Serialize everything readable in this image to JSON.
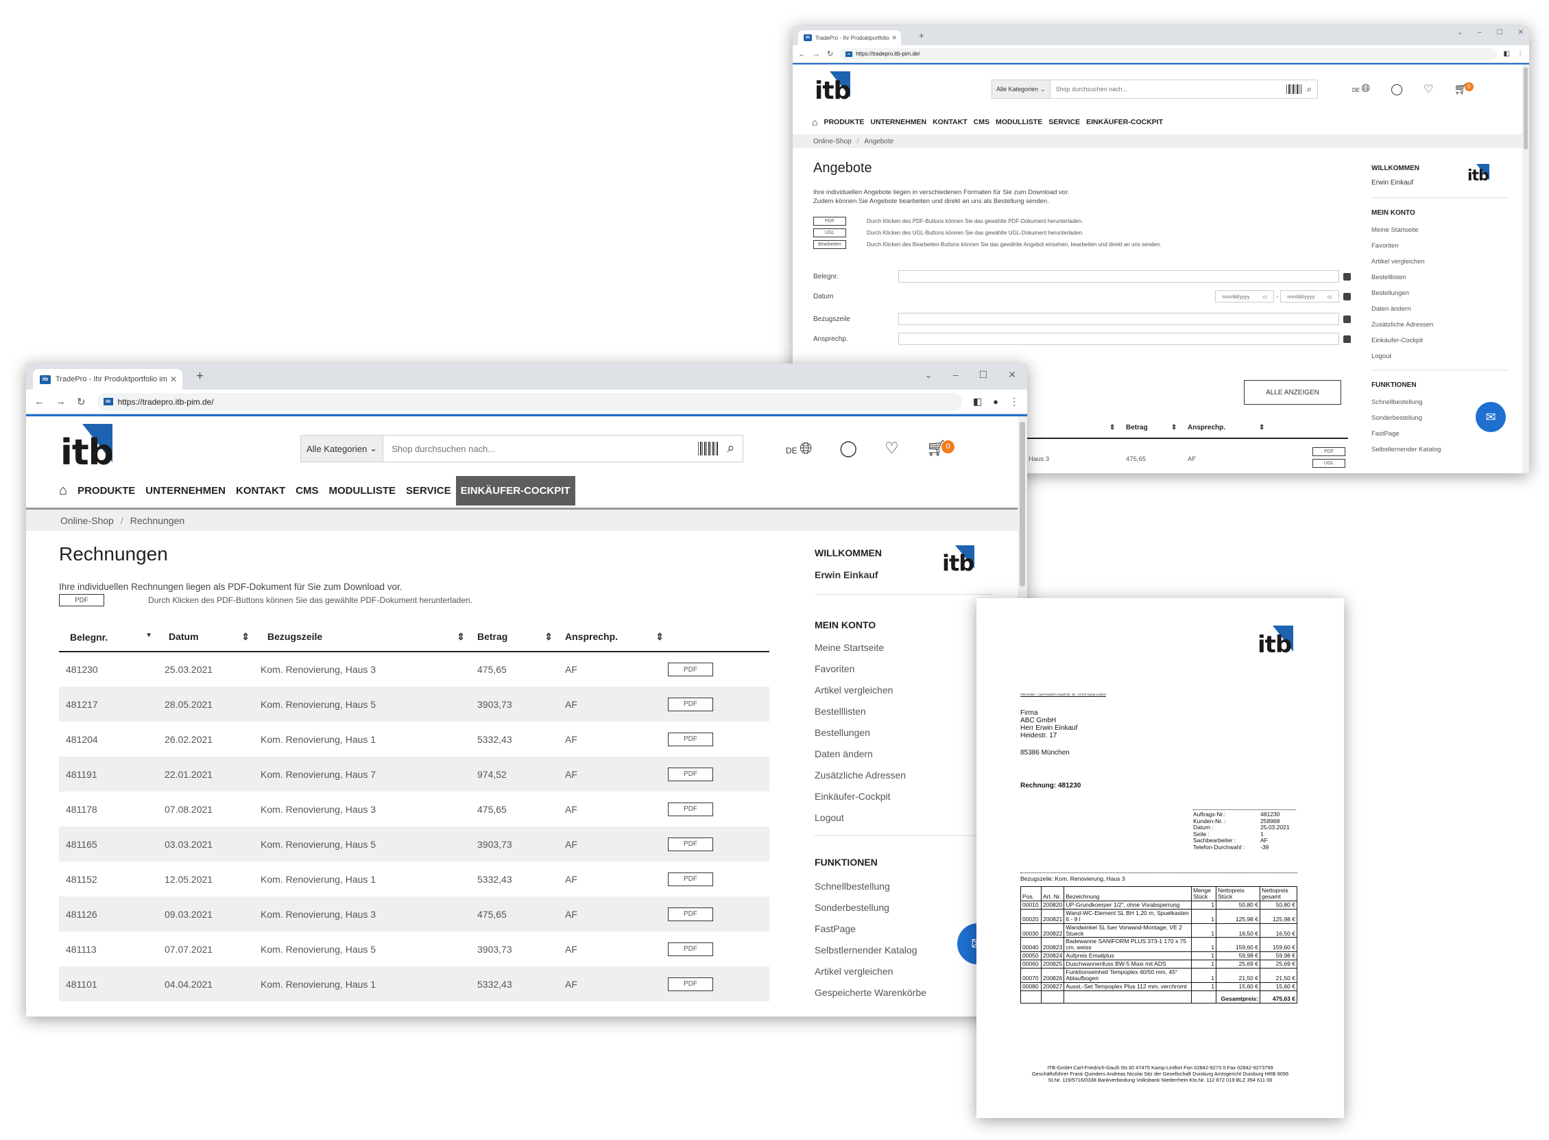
{
  "browser": {
    "tab_title": "TradePro - Ihr Produktportfolio im Überblick",
    "url": "https://tradepro.itb-pim.de/",
    "favicon": "itb"
  },
  "brand": {
    "logo": "itb",
    "color": "#1e63b0",
    "accent": "#f07d1a"
  },
  "header": {
    "category": "Alle Kategorien",
    "search_placeholder": "Shop durchsuchen nach...",
    "lang": "DE",
    "cart_count": "0"
  },
  "nav": [
    "PRODUKTE",
    "UNTERNEHMEN",
    "KONTAKT",
    "CMS",
    "MODULLISTE",
    "SERVICE",
    "EINKÄUFER-COCKPIT"
  ],
  "front": {
    "breadcrumb": [
      "Online-Shop",
      "Rechnungen"
    ],
    "title": "Rechnungen",
    "intro": "Ihre individuellen Rechnungen liegen als PDF-Dokument für Sie zum Download vor.",
    "pdf_legend": "Durch Klicken des PDF-Buttons können Sie das gewählte PDF-Dokument herunterladen.",
    "columns": [
      "Belegnr.",
      "Datum",
      "Bezugszeile",
      "Betrag",
      "Ansprechp."
    ],
    "rows": [
      {
        "beleg": "481230",
        "datum": "25.03.2021",
        "bezug": "Kom. Renovierung, Haus 3",
        "betrag": "475,65",
        "ansp": "AF"
      },
      {
        "beleg": "481217",
        "datum": "28.05.2021",
        "bezug": "Kom. Renovierung, Haus 5",
        "betrag": "3903,73",
        "ansp": "AF"
      },
      {
        "beleg": "481204",
        "datum": "26.02.2021",
        "bezug": "Kom. Renovierung, Haus 1",
        "betrag": "5332,43",
        "ansp": "AF"
      },
      {
        "beleg": "481191",
        "datum": "22.01.2021",
        "bezug": "Kom. Renovierung, Haus 7",
        "betrag": "974,52",
        "ansp": "AF"
      },
      {
        "beleg": "481178",
        "datum": "07.08.2021",
        "bezug": "Kom. Renovierung, Haus 3",
        "betrag": "475,65",
        "ansp": "AF"
      },
      {
        "beleg": "481165",
        "datum": "03.03.2021",
        "bezug": "Kom. Renovierung, Haus 5",
        "betrag": "3903,73",
        "ansp": "AF"
      },
      {
        "beleg": "481152",
        "datum": "12.05.2021",
        "bezug": "Kom. Renovierung, Haus 1",
        "betrag": "5332,43",
        "ansp": "AF"
      },
      {
        "beleg": "481126",
        "datum": "09.03.2021",
        "bezug": "Kom. Renovierung, Haus 3",
        "betrag": "475,65",
        "ansp": "AF"
      },
      {
        "beleg": "481113",
        "datum": "07.07.2021",
        "bezug": "Kom. Renovierung, Haus 5",
        "betrag": "3903,73",
        "ansp": "AF"
      },
      {
        "beleg": "481101",
        "datum": "04.04.2021",
        "bezug": "Kom. Renovierung, Haus 1",
        "betrag": "5332,43",
        "ansp": "AF"
      }
    ],
    "pdf_label": "PDF"
  },
  "sidebar": {
    "welcome": "WILLKOMMEN",
    "user": "Erwin Einkauf",
    "account_title": "MEIN KONTO",
    "account": [
      "Meine Startseite",
      "Favoriten",
      "Artikel vergleichen",
      "Bestelllisten",
      "Bestellungen",
      "Daten ändern",
      "Zusätzliche Adressen",
      "Einkäufer-Cockpit",
      "Logout"
    ],
    "functions_title": "FUNKTIONEN",
    "functions": [
      "Schnellbestellung",
      "Sonderbestellung",
      "FastPage",
      "Selbstlernender Katalog",
      "Artikel vergleichen",
      "Gespeicherte Warenkörbe"
    ]
  },
  "back": {
    "breadcrumb": [
      "Online-Shop",
      "Angebote"
    ],
    "title": "Angebote",
    "intro1": "Ihre individuellen Angebote liegen in verschiedenen Formaten für Sie zum Download vor.",
    "intro2": "Zudem können Sie Angebote bearbeiten und direkt an uns als Bestellung senden.",
    "legend": [
      {
        "btn": "PDF",
        "text": "Durch Klicken des PDF-Buttons können Sie das gewählte PDF-Dokument herunterladen."
      },
      {
        "btn": "UGL",
        "text": "Durch Klicken des UGL-Buttons können Sie das gewählte UGL-Dokument herunterladen."
      },
      {
        "btn": "Bearbeiten",
        "text": "Durch Klicken des Bearbeiten-Buttons können Sie das gewählte Angebot einsehen, bearbeiten und direkt an uns senden."
      }
    ],
    "filters": [
      "Belegnr.",
      "Datum",
      "Bezugszeile",
      "Ansprechp."
    ],
    "date_placeholder": "mm/dd/yyyy",
    "show_all": "ALLE ANZEIGEN",
    "columns": [
      "Betrag",
      "Ansprechp."
    ],
    "row": {
      "bezug": "Haus 3",
      "betrag": "475,65",
      "ansp": "AF"
    },
    "buttons": [
      "PDF",
      "UGL"
    ]
  },
  "invoice": {
    "sender_line": "ITB-GmbH · Carl-Friedrich-Gauß-Str. 30 · 47475 Kamp-Lintfort",
    "recipient": [
      "Firma",
      "ABC GmbH",
      "Herr Erwin Einkauf",
      "Heidestr. 17",
      "",
      "85386 München"
    ],
    "title": "Rechnung: 481230",
    "meta": [
      {
        "k": "Auftrags-Nr.:",
        "v": "481230"
      },
      {
        "k": "Kunden-Nr. :",
        "v": "258968"
      },
      {
        "k": "Datum :",
        "v": "25.03.2021"
      },
      {
        "k": "Seite :",
        "v": "1"
      },
      {
        "k": "Sachbearbeiter :",
        "v": "AF"
      },
      {
        "k": "Telefon-Durchwahl :",
        "v": "-39"
      }
    ],
    "bezug": "Bezugszeile: Kom. Renovierung, Haus 3",
    "head": [
      "Pos.",
      "Art. Nr.",
      "Bezeichnung",
      "Menge Stück",
      "Nettopreis Stück",
      "Nettopreis gesamt"
    ],
    "items": [
      [
        "00010",
        "200820",
        "UP-Grundkoerper 1/2\", ohne Vorabsperrung",
        "1",
        "50,80 €",
        "50,80 €"
      ],
      [
        "00020",
        "200821",
        "Wand-WC-Element SL BH 1,20 m, Spuelkasten 6 - 9 l",
        "1",
        "125,98 €",
        "125,98 €"
      ],
      [
        "00030",
        "200822",
        "Wandwinkel SL fuer Vorwand-Montage, VE 2 Stueck",
        "1",
        "16,50 €",
        "16,50 €"
      ],
      [
        "00040",
        "200823",
        "Badewanne SANIFORM PLUS 373-1 170 x 75 cm, weiss",
        "1",
        "159,60 €",
        "159,60 €"
      ],
      [
        "00050",
        "200824",
        "Aufpreis Emailplus",
        "1",
        "59,98 €",
        "59,98 €"
      ],
      [
        "00060",
        "200825",
        "Duschwannenfuss BW-5 Maxi mit ADS",
        "1",
        "25,69 €",
        "25,69 €"
      ],
      [
        "00070",
        "200826",
        "Funktionseinheit Tempoplex 40/50 mm, 45° Ablaufbogen",
        "1",
        "21,50 €",
        "21,50 €"
      ],
      [
        "00080",
        "200827",
        "Ausst.-Set Tempoplex Plus 112 mm, verchromt",
        "1",
        "15,60 €",
        "15,60 €"
      ]
    ],
    "total_label": "Gesamtpreis:",
    "total": "475,63 €",
    "footer": [
      "ITB-GmbH Carl-Friedrich-Gauß-Str.30 47475 Kamp-Lintfort Fon 02842-9273 0 Fax 02842-9273799",
      "Geschäftsführer Frank Quinders  Andreas Nicolai Sitz der Gesellschaft Duisburg Amtsgericht Duisburg HRB 9056",
      "St.Nr. 119/5716/0338 Bankverbindung Volksbank Niederrhein  Kto.Nr. 112 872 019  BLZ  354 611 06"
    ]
  }
}
